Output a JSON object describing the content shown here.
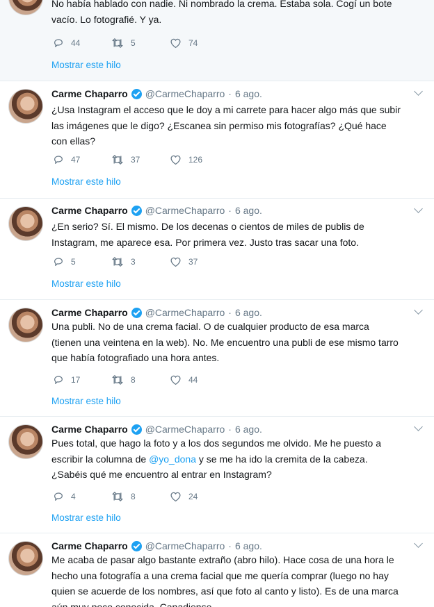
{
  "tweets": [
    {
      "text_lines": [
        "No había hablado con nadie. Ni nombrado la crema. Estaba sola. Cogí un bote",
        "vacío. Lo fotografié. Y ya."
      ],
      "replies": "44",
      "retweets": "5",
      "likes": "74",
      "show_thread": "Mostrar este hilo"
    },
    {
      "name": "Carme Chaparro",
      "handle": "@CarmeChaparro",
      "dot": "·",
      "time": "6 ago.",
      "text_lines": [
        "¿Usa Instagram el acceso que le doy a mi carrete para hacer algo más que subir",
        "las imágenes que le digo? ¿Escanea sin permiso mis fotografías? ¿Qué hace",
        "con ellas?"
      ],
      "replies": "47",
      "retweets": "37",
      "likes": "126",
      "show_thread": "Mostrar este hilo"
    },
    {
      "name": "Carme Chaparro",
      "handle": "@CarmeChaparro",
      "dot": "·",
      "time": "6 ago.",
      "text_lines": [
        "¿En serio? Sí. El mismo. De los decenas o cientos de miles de publis de",
        "Instagram, me aparece esa. Por primera vez. Justo tras sacar una foto."
      ],
      "replies": "5",
      "retweets": "3",
      "likes": "37",
      "show_thread": "Mostrar este hilo"
    },
    {
      "name": "Carme Chaparro",
      "handle": "@CarmeChaparro",
      "dot": "·",
      "time": "6 ago.",
      "text_lines": [
        "Una publi. No de una crema facial. O de cualquier producto de esa marca",
        "(tienen una veintena en la web). No. Me encuentro una publi de ese mismo tarro",
        "que había fotografiado una hora antes."
      ],
      "replies": "17",
      "retweets": "8",
      "likes": "44",
      "show_thread": "Mostrar este hilo"
    },
    {
      "name": "Carme Chaparro",
      "handle": "@CarmeChaparro",
      "dot": "·",
      "time": "6 ago.",
      "text_line1": "Pues total, que hago la foto y a los dos segundos me olvido. Me he puesto a",
      "text_line2_before": "escribir la columna de ",
      "text_line2_mention": "@yo_dona",
      "text_line2_after": " y se me ha ido la cremita de la cabeza.",
      "text_line3": "¿Sabéis qué me encuentro al entrar en Instagram?",
      "replies": "4",
      "retweets": "8",
      "likes": "24",
      "show_thread": "Mostrar este hilo"
    },
    {
      "name": "Carme Chaparro",
      "handle": "@CarmeChaparro",
      "dot": "·",
      "time": "6 ago.",
      "text_lines": [
        "Me acaba de pasar algo bastante extraño (abro hilo). Hace cosa de una hora le",
        "hecho una fotografía a una crema facial que me quería comprar (luego no hay",
        "quien se acuerde de los nombres, así que foto al canto y listo). Es de una marca",
        "aún muy poco conocida. Canadiense."
      ]
    }
  ],
  "colors": {
    "accent": "#1da1f2",
    "muted": "#657786",
    "text": "#14171a",
    "divider": "#e6ecf0"
  }
}
